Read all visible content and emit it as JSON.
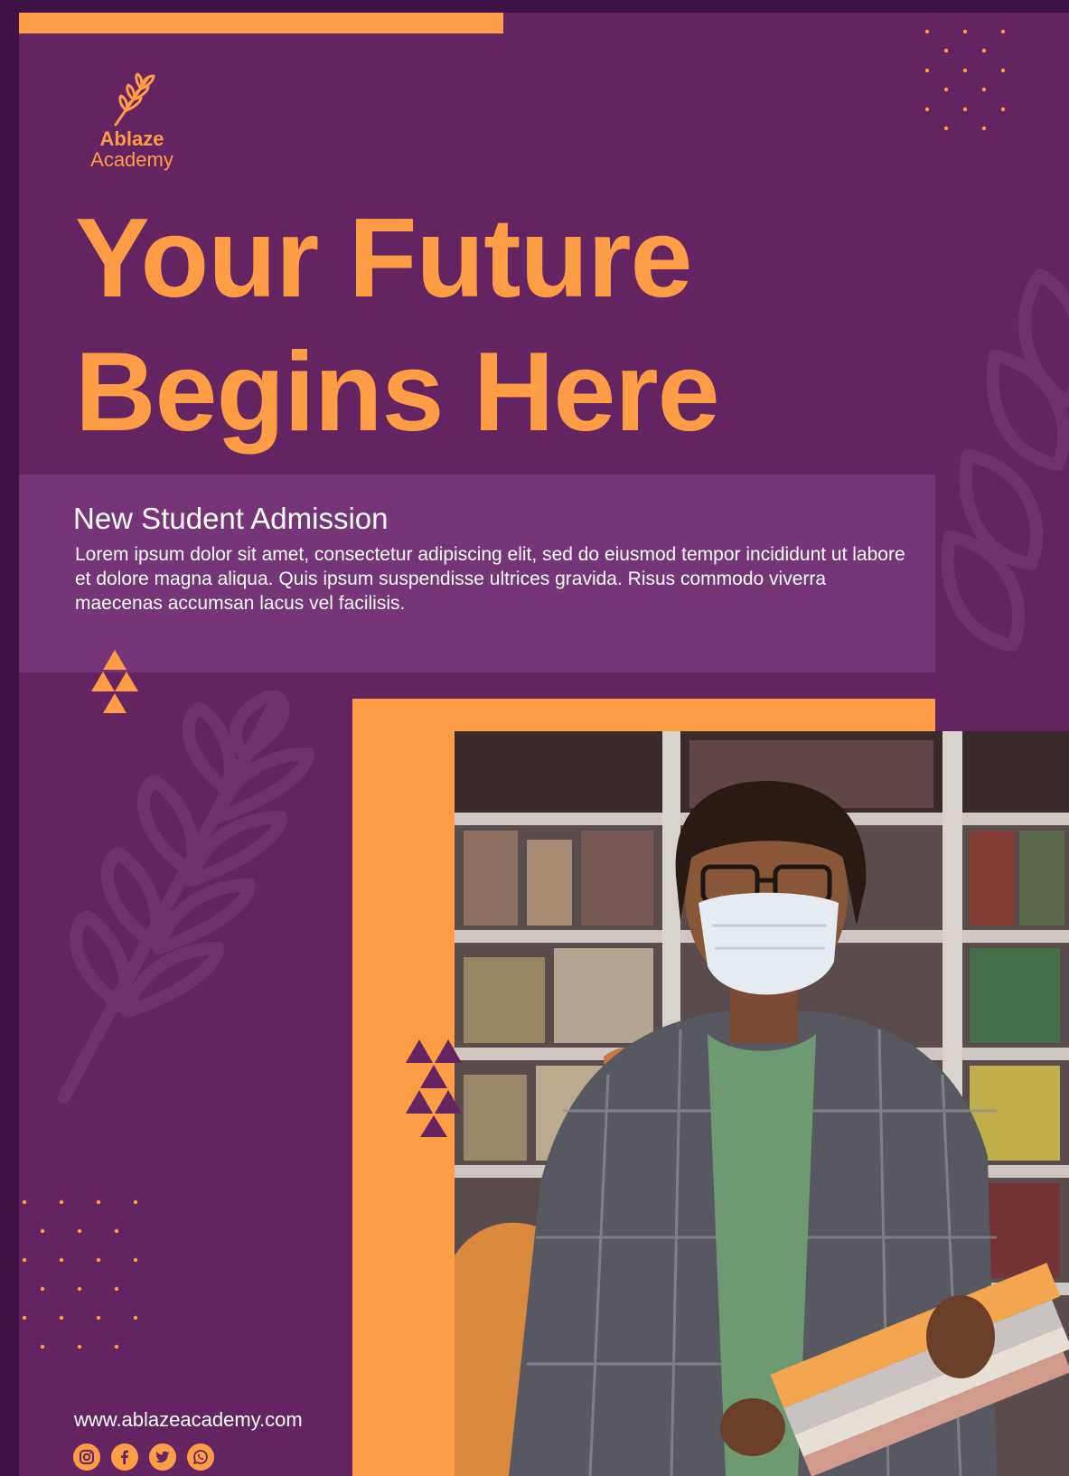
{
  "brand": {
    "name": "Ablaze",
    "sub": "Academy"
  },
  "headline": {
    "line1": "Your Future",
    "line2": "Begins Here"
  },
  "admission": {
    "title": "New Student Admission",
    "body": "Lorem ipsum dolor sit amet, consectetur adipiscing elit, sed do eiusmod tempor incididunt ut labore et dolore magna aliqua. Quis ipsum suspendisse ultrices gravida. Risus commodo viverra maecenas accumsan lacus vel facilisis."
  },
  "footer": {
    "website": "www.ablazeacademy.com",
    "socials": [
      "instagram-icon",
      "facebook-icon",
      "twitter-icon",
      "whatsapp-icon"
    ]
  },
  "colors": {
    "background": "#632461",
    "panel": "#773579",
    "accent": "#ff9d47",
    "text": "#ffffff"
  }
}
